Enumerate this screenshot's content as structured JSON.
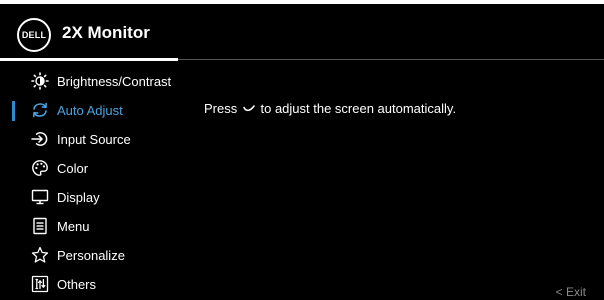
{
  "header": {
    "logo_text": "DELL",
    "title": "2X Monitor"
  },
  "menu": {
    "items": [
      {
        "label": "Brightness/Contrast",
        "icon": "brightness-icon"
      },
      {
        "label": "Auto Adjust",
        "icon": "auto-adjust-icon",
        "selected": true
      },
      {
        "label": "Input Source",
        "icon": "input-source-icon"
      },
      {
        "label": "Color",
        "icon": "color-palette-icon"
      },
      {
        "label": "Display",
        "icon": "display-icon"
      },
      {
        "label": "Menu",
        "icon": "menu-icon"
      },
      {
        "label": "Personalize",
        "icon": "star-icon"
      },
      {
        "label": "Others",
        "icon": "others-icon"
      }
    ]
  },
  "content": {
    "message_before": "Press",
    "message_after": "to adjust the screen automatically.",
    "message_icon": "checkmark-icon"
  },
  "footer": {
    "exit_label": "< Exit"
  },
  "colors": {
    "background": "#000000",
    "text": "#ffffff",
    "accent": "#2d8bcb",
    "selected_text": "#4aa3df",
    "muted": "#8a8a8a"
  }
}
